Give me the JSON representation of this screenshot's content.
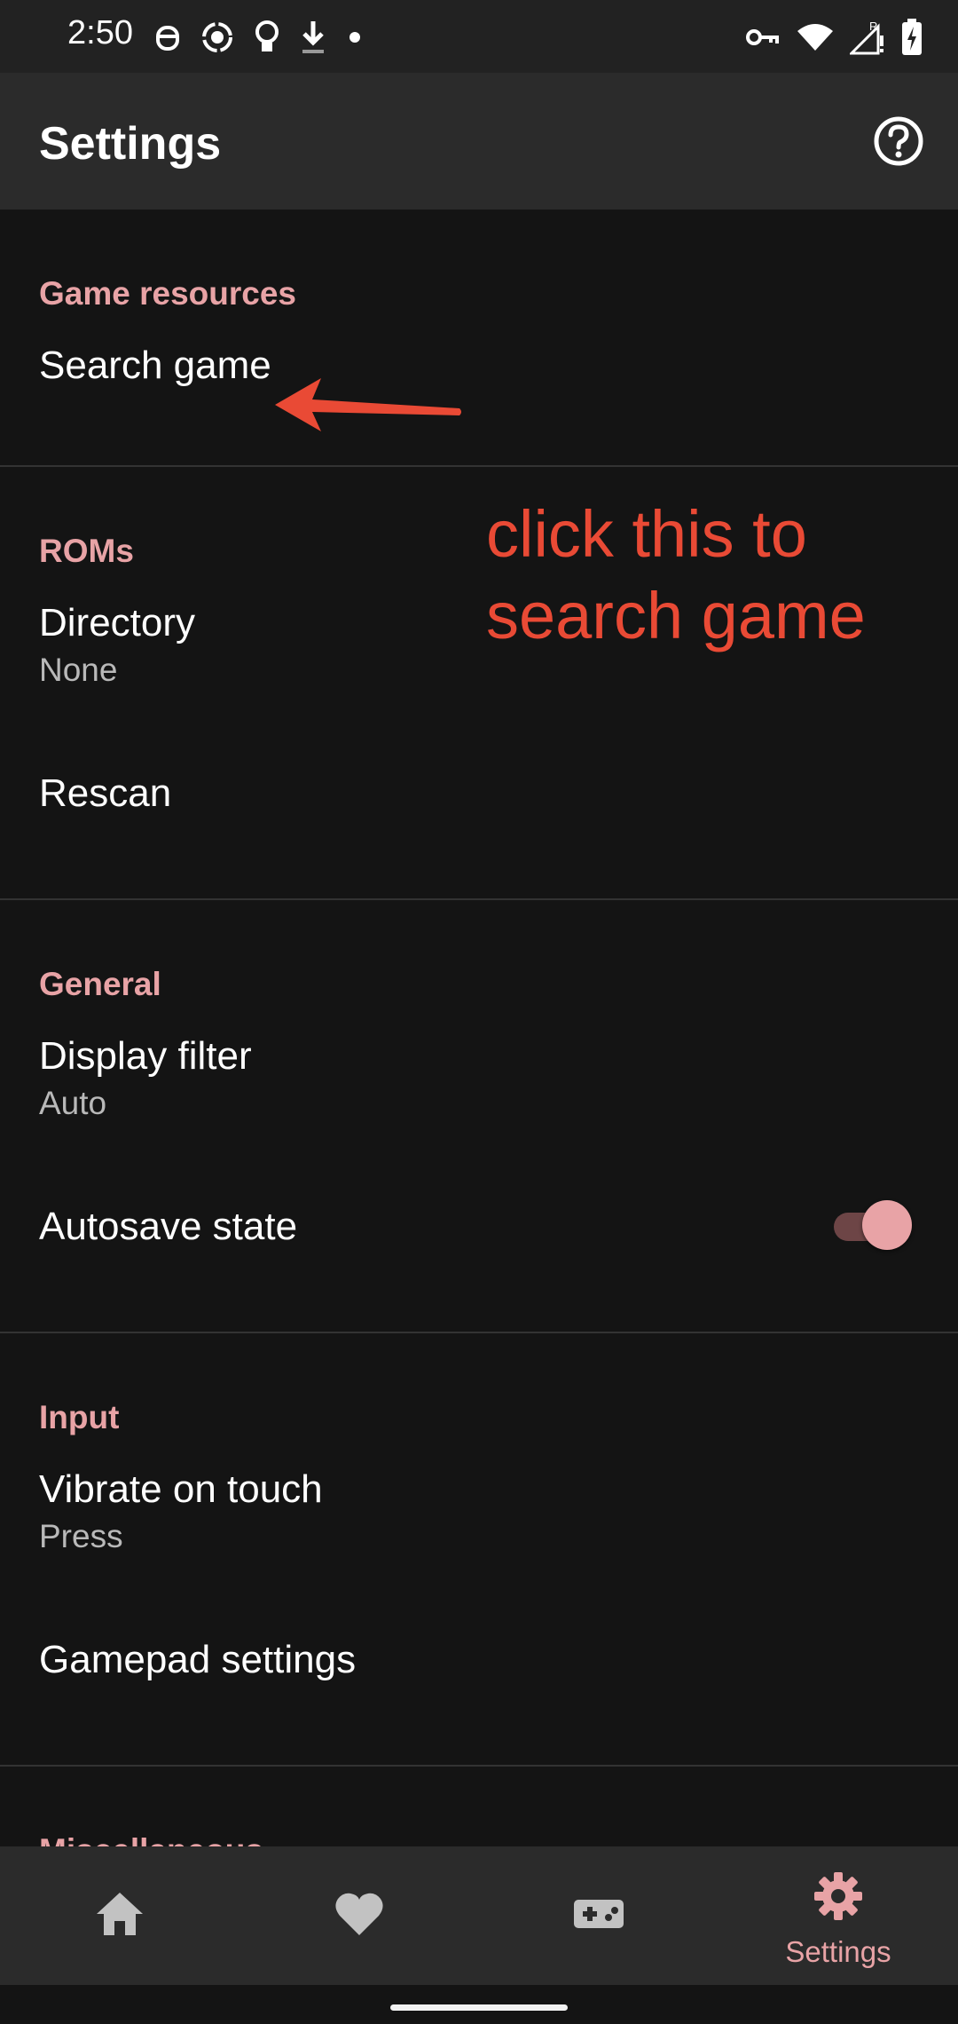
{
  "status_bar": {
    "time": "2:50",
    "left_icons": [
      "robot-icon",
      "screen-record-icon",
      "lightbulb-icon",
      "download-icon",
      "dot-icon"
    ],
    "right_icons": [
      "vpn-key-icon",
      "wifi-icon",
      "signal-icon",
      "battery-charging-icon"
    ]
  },
  "app_bar": {
    "title": "Settings",
    "help_icon": "help-circle-icon"
  },
  "sections": {
    "game_resources": {
      "header": "Game resources",
      "search_game": "Search game"
    },
    "roms": {
      "header": "ROMs",
      "directory_title": "Directory",
      "directory_summary": "None",
      "rescan": "Rescan"
    },
    "general": {
      "header": "General",
      "display_filter_title": "Display filter",
      "display_filter_summary": "Auto",
      "autosave_state": "Autosave state",
      "autosave_enabled": true
    },
    "input": {
      "header": "Input",
      "vibrate_title": "Vibrate on touch",
      "vibrate_summary": "Press",
      "gamepad_settings": "Gamepad settings"
    },
    "misc": {
      "header": "Miscellaneous"
    }
  },
  "annotation": {
    "line1": "click this to",
    "line2": "search game",
    "color": "#e94a35"
  },
  "bottom_nav": {
    "items": [
      {
        "icon": "home-icon",
        "label": ""
      },
      {
        "icon": "heart-icon",
        "label": ""
      },
      {
        "icon": "gamepad-icon",
        "label": ""
      },
      {
        "icon": "gear-icon",
        "label": "Settings",
        "active": true
      }
    ]
  },
  "colors": {
    "accent": "#e8a3a6",
    "background": "#141414",
    "app_bar": "#2b2b2b"
  }
}
